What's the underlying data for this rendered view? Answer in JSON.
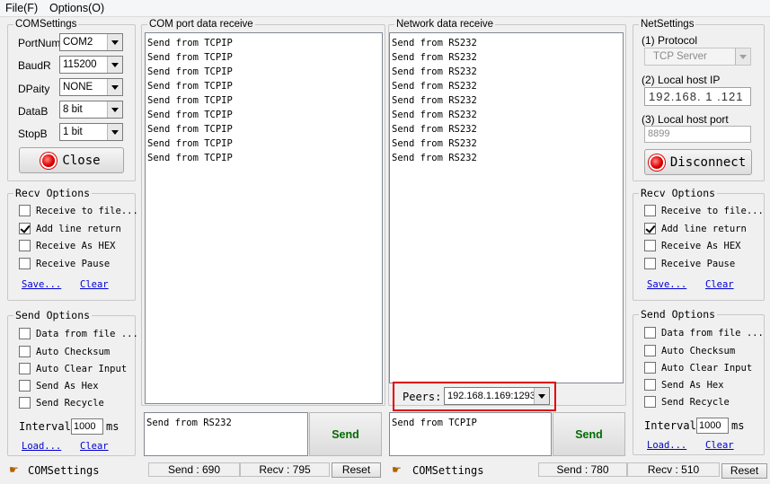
{
  "menu": {
    "file": "File(F)",
    "options": "Options(O)"
  },
  "com_settings": {
    "title": "COMSettings",
    "fields": [
      {
        "label": "PortNum",
        "value": "COM2"
      },
      {
        "label": "BaudR",
        "value": "115200"
      },
      {
        "label": "DPaity",
        "value": "NONE"
      },
      {
        "label": "DataB",
        "value": "8 bit"
      },
      {
        "label": "StopB",
        "value": "1 bit"
      }
    ],
    "close_label": "Close"
  },
  "left_recv": {
    "title": "Recv Options",
    "options": [
      "Receive to file...",
      "Add line return",
      "Receive As HEX",
      "Receive Pause"
    ],
    "checked": [
      false,
      true,
      false,
      false
    ],
    "save": "Save...",
    "clear": "Clear"
  },
  "left_send": {
    "title": "Send Options",
    "options": [
      "Data from file ...",
      "Auto Checksum",
      "Auto Clear Input",
      "Send As Hex",
      "Send Recycle"
    ],
    "interval_label": "Interval",
    "interval_value": "1000",
    "interval_unit": "ms",
    "load": "Load...",
    "clear": "Clear"
  },
  "com_receive": {
    "title": "COM port data receive",
    "lines": [
      "Send from TCPIP",
      "Send from TCPIP",
      "Send from TCPIP",
      "Send from TCPIP",
      "Send from TCPIP",
      "Send from TCPIP",
      "Send from TCPIP",
      "Send from TCPIP",
      "Send from TCPIP"
    ],
    "input": "Send from RS232",
    "send_label": "Send"
  },
  "net_receive": {
    "title": "Network data receive",
    "lines": [
      "Send from RS232",
      "Send from RS232",
      "Send from RS232",
      "Send from RS232",
      "Send from RS232",
      "Send from RS232",
      "Send from RS232",
      "Send from RS232",
      "Send from RS232"
    ],
    "peers_label": "Peers:",
    "peers_value": "192.168.1.169:1293",
    "input": "Send from TCPIP",
    "send_label": "Send"
  },
  "net_settings": {
    "title": "NetSettings",
    "protocol_label": "(1) Protocol",
    "protocol_value": "TCP Server",
    "ip_label": "(2) Local host IP",
    "ip_parts": [
      "192",
      "168",
      "1",
      "121"
    ],
    "port_label": "(3) Local host port",
    "port_value": "8899",
    "disconnect_label": "Disconnect"
  },
  "right_recv": {
    "title": "Recv Options",
    "options": [
      "Receive to file...",
      "Add line return",
      "Receive As HEX",
      "Receive Pause"
    ],
    "checked": [
      false,
      true,
      false,
      false
    ],
    "save": "Save...",
    "clear": "Clear"
  },
  "right_send": {
    "title": "Send Options",
    "options": [
      "Data from file ...",
      "Auto Checksum",
      "Auto Clear Input",
      "Send As Hex",
      "Send Recycle"
    ],
    "interval_label": "Interval",
    "interval_value": "1000",
    "interval_unit": "ms",
    "load": "Load...",
    "clear": "Clear"
  },
  "status": {
    "left_label": "COMSettings",
    "left_send": "Send : 690",
    "left_recv": "Recv : 795",
    "left_reset": "Reset",
    "right_label": "COMSettings",
    "right_send": "Send : 780",
    "right_recv": "Recv : 510",
    "right_reset": "Reset"
  }
}
